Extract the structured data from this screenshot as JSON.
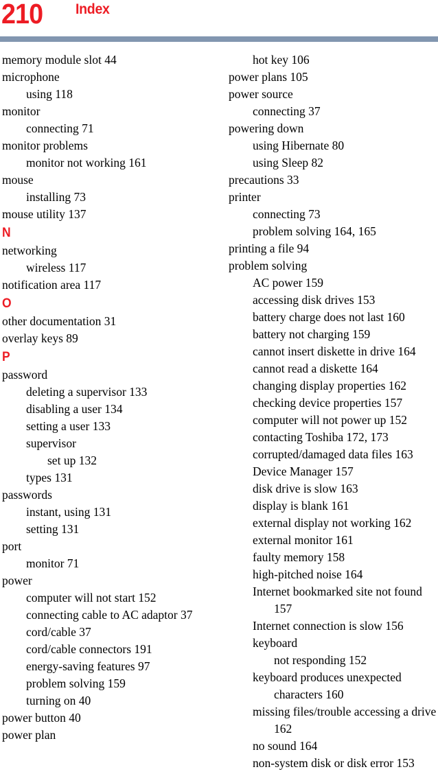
{
  "header": {
    "page_number": "210",
    "title": "Index",
    "page_number_color": "#ed1c24",
    "title_color": "#ed1c24",
    "rule_color": "#8296b0"
  },
  "columns": {
    "left": [
      {
        "kind": "entry",
        "level": 0,
        "text": "memory module slot 44"
      },
      {
        "kind": "entry",
        "level": 0,
        "text": "microphone"
      },
      {
        "kind": "entry",
        "level": 1,
        "text": "using 118"
      },
      {
        "kind": "entry",
        "level": 0,
        "text": "monitor"
      },
      {
        "kind": "entry",
        "level": 1,
        "text": "connecting 71"
      },
      {
        "kind": "entry",
        "level": 0,
        "text": "monitor problems"
      },
      {
        "kind": "entry",
        "level": 1,
        "text": "monitor not working 161"
      },
      {
        "kind": "entry",
        "level": 0,
        "text": "mouse"
      },
      {
        "kind": "entry",
        "level": 1,
        "text": "installing 73"
      },
      {
        "kind": "entry",
        "level": 0,
        "text": "mouse utility 137"
      },
      {
        "kind": "letter",
        "text": "N"
      },
      {
        "kind": "entry",
        "level": 0,
        "text": "networking"
      },
      {
        "kind": "entry",
        "level": 1,
        "text": "wireless 117"
      },
      {
        "kind": "entry",
        "level": 0,
        "text": "notification area 117"
      },
      {
        "kind": "letter",
        "text": "O"
      },
      {
        "kind": "entry",
        "level": 0,
        "text": "other documentation 31"
      },
      {
        "kind": "entry",
        "level": 0,
        "text": "overlay keys 89"
      },
      {
        "kind": "letter",
        "text": "P"
      },
      {
        "kind": "entry",
        "level": 0,
        "text": "password"
      },
      {
        "kind": "entry",
        "level": 1,
        "text": "deleting a supervisor 133"
      },
      {
        "kind": "entry",
        "level": 1,
        "text": "disabling a user 134"
      },
      {
        "kind": "entry",
        "level": 1,
        "text": "setting a user 133"
      },
      {
        "kind": "entry",
        "level": 1,
        "text": "supervisor"
      },
      {
        "kind": "entry",
        "level": 2,
        "text": "set up 132"
      },
      {
        "kind": "entry",
        "level": 1,
        "text": "types 131"
      },
      {
        "kind": "entry",
        "level": 0,
        "text": "passwords"
      },
      {
        "kind": "entry",
        "level": 1,
        "text": "instant, using 131"
      },
      {
        "kind": "entry",
        "level": 1,
        "text": "setting 131"
      },
      {
        "kind": "entry",
        "level": 0,
        "text": "port"
      },
      {
        "kind": "entry",
        "level": 1,
        "text": "monitor 71"
      },
      {
        "kind": "entry",
        "level": 0,
        "text": "power"
      },
      {
        "kind": "entry",
        "level": 1,
        "text": "computer will not start 152"
      },
      {
        "kind": "entry",
        "level": 1,
        "wrap": true,
        "text": "connecting cable to AC adaptor 37"
      },
      {
        "kind": "entry",
        "level": 1,
        "text": "cord/cable 37"
      },
      {
        "kind": "entry",
        "level": 1,
        "text": "cord/cable connectors 191"
      },
      {
        "kind": "entry",
        "level": 1,
        "text": "energy-saving features 97"
      },
      {
        "kind": "entry",
        "level": 1,
        "text": "problem solving 159"
      },
      {
        "kind": "entry",
        "level": 1,
        "text": "turning on 40"
      },
      {
        "kind": "entry",
        "level": 0,
        "text": "power button 40"
      },
      {
        "kind": "entry",
        "level": 0,
        "text": "power plan"
      }
    ],
    "right": [
      {
        "kind": "entry",
        "level": 1,
        "text": "hot key 106"
      },
      {
        "kind": "entry",
        "level": 0,
        "text": "power plans 105"
      },
      {
        "kind": "entry",
        "level": 0,
        "text": "power source"
      },
      {
        "kind": "entry",
        "level": 1,
        "text": "connecting 37"
      },
      {
        "kind": "entry",
        "level": 0,
        "text": "powering down"
      },
      {
        "kind": "entry",
        "level": 1,
        "text": "using Hibernate 80"
      },
      {
        "kind": "entry",
        "level": 1,
        "text": "using Sleep 82"
      },
      {
        "kind": "entry",
        "level": 0,
        "text": "precautions 33"
      },
      {
        "kind": "entry",
        "level": 0,
        "text": "printer"
      },
      {
        "kind": "entry",
        "level": 1,
        "text": "connecting 73"
      },
      {
        "kind": "entry",
        "level": 1,
        "text": "problem solving 164, 165"
      },
      {
        "kind": "entry",
        "level": 0,
        "text": "printing a file 94"
      },
      {
        "kind": "entry",
        "level": 0,
        "text": "problem solving"
      },
      {
        "kind": "entry",
        "level": 1,
        "text": "AC power 159"
      },
      {
        "kind": "entry",
        "level": 1,
        "text": "accessing disk drives 153"
      },
      {
        "kind": "entry",
        "level": 1,
        "text": "battery charge does not last 160"
      },
      {
        "kind": "entry",
        "level": 1,
        "text": "battery not charging 159"
      },
      {
        "kind": "entry",
        "level": 1,
        "text": "cannot insert diskette in drive 164"
      },
      {
        "kind": "entry",
        "level": 1,
        "text": "cannot read a diskette 164"
      },
      {
        "kind": "entry",
        "level": 1,
        "text": "changing display properties 162"
      },
      {
        "kind": "entry",
        "level": 1,
        "text": "checking device properties 157"
      },
      {
        "kind": "entry",
        "level": 1,
        "text": "computer will not power up 152"
      },
      {
        "kind": "entry",
        "level": 1,
        "text": "contacting Toshiba 172, 173"
      },
      {
        "kind": "entry",
        "level": 1,
        "text": "corrupted/damaged data files 163"
      },
      {
        "kind": "entry",
        "level": 1,
        "text": "Device Manager 157"
      },
      {
        "kind": "entry",
        "level": 1,
        "text": "disk drive is slow 163"
      },
      {
        "kind": "entry",
        "level": 1,
        "text": "display is blank 161"
      },
      {
        "kind": "entry",
        "level": 1,
        "text": "external display not working 162"
      },
      {
        "kind": "entry",
        "level": 1,
        "text": "external monitor 161"
      },
      {
        "kind": "entry",
        "level": 1,
        "text": "faulty memory 158"
      },
      {
        "kind": "entry",
        "level": 1,
        "text": "high-pitched noise 164"
      },
      {
        "kind": "entry",
        "level": 1,
        "wrap": true,
        "text": "Internet bookmarked site not found 157"
      },
      {
        "kind": "entry",
        "level": 1,
        "text": "Internet connection is slow 156"
      },
      {
        "kind": "entry",
        "level": 1,
        "text": "keyboard"
      },
      {
        "kind": "entry",
        "level": 2,
        "text": "not responding 152"
      },
      {
        "kind": "entry",
        "level": 1,
        "wrap": true,
        "text": "keyboard produces unexpected characters 160"
      },
      {
        "kind": "entry",
        "level": 1,
        "wrap": true,
        "text": "missing files/trouble accessing a drive 162"
      },
      {
        "kind": "entry",
        "level": 1,
        "text": "no sound 164"
      },
      {
        "kind": "entry",
        "level": 1,
        "text": "non-system disk or disk error 153"
      }
    ]
  }
}
